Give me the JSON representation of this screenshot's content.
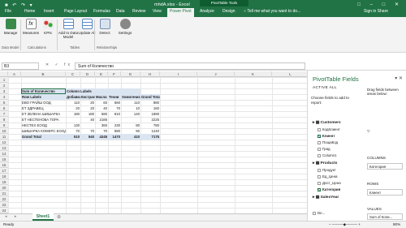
{
  "window": {
    "title": "mhdA.xlsx - Excel",
    "tools_title": "PivotTable Tools",
    "quick_access": "■ ↶ ↷ ▾",
    "window_controls": "□ – □ ✕"
  },
  "ribbon_tabs": [
    "File",
    "Home",
    "Insert",
    "Page Layout",
    "Formulas",
    "Data",
    "Review",
    "View",
    "Power Pivot",
    "Analyze",
    "Design"
  ],
  "tell_me": "○ Tell me what you want to do...",
  "user_area": "Sign in  Share",
  "ribbon": {
    "buttons": [
      "Manage",
      "Measures",
      "KPIs",
      "Add to Data Model",
      "Update All",
      "Detect",
      "Settings"
    ],
    "groups": [
      "Data Model",
      "Calculations",
      "Tables",
      "Relationships"
    ]
  },
  "formula_bar": {
    "name_box": "B3",
    "fx_icons": "✕ ✓ fx",
    "formula": "Sum of Количество"
  },
  "columns": [
    "A",
    "B",
    "C",
    "D",
    "E",
    "F",
    "G",
    "H",
    "I",
    "J",
    "K",
    "L"
  ],
  "rows": [
    "1",
    "2",
    "3",
    "4",
    "5",
    "6",
    "7",
    "8",
    "9",
    "10",
    "11",
    "12",
    "13",
    "14",
    "15",
    "16",
    "17",
    "18",
    "19",
    "20",
    "21",
    "22",
    "23",
    "24"
  ],
  "pivot": {
    "value_header": "Sum of Количество",
    "column_labels": "Column Labels",
    "row_labels": "Row Labels",
    "col_headers": [
      "Добавки",
      "Екстракти",
      "Масла",
      "Течни",
      "Хомогениз",
      "Grand Total"
    ],
    "data_rows": [
      {
        "label": "ЕВО ГРАЙШ ООД",
        "values": [
          "110",
          "20",
          "60",
          "560",
          "110",
          "880"
        ]
      },
      {
        "label": "ЕТ ЗДРАВЕЦ",
        "values": [
          "20",
          "20",
          "40",
          "70",
          "10",
          "160"
        ]
      },
      {
        "label": "ЕТ ЗЕЛЕНА ШИШАРКА",
        "values": [
          "180",
          "180",
          "580",
          "810",
          "140",
          "1890"
        ]
      },
      {
        "label": "ЕТ НЕСТЕНОВА ТОРА",
        "values": [
          "",
          "40",
          "2185",
          "",
          "",
          "2225"
        ]
      },
      {
        "label": "НЕСТЕХ ЕООД",
        "values": [
          "130",
          "",
          "360",
          "230",
          "80",
          "780"
        ]
      },
      {
        "label": "ШИШАРКА КОМЕРС ЕООД",
        "values": [
          "70",
          "70",
          "70",
          "980",
          "90",
          "1240"
        ]
      }
    ],
    "grand_total_label": "Grand Total",
    "grand_totals": [
      "510",
      "540",
      "4245",
      "1470",
      "410",
      "7175"
    ]
  },
  "sheet_tab": "Sheet1",
  "status": {
    "ready": "Ready",
    "zoom": "80%",
    "zoom_controls": "– ———◆——— +"
  },
  "pivot_panel": {
    "title": "PivotTable Fields",
    "tabs": "ACTIVE    ALL",
    "choose_text": "Choose fields to add to report:",
    "drag_text": "Drag fields between areas below:",
    "tables": [
      {
        "name": "Customers",
        "fields": [
          {
            "name": "КодКлиент",
            "checked": false
          },
          {
            "name": "Клиент",
            "checked": true
          },
          {
            "name": "ПощаКод",
            "checked": false
          },
          {
            "name": "Град",
            "checked": false
          },
          {
            "name": "Column1",
            "checked": false
          }
        ]
      },
      {
        "name": "Products",
        "fields": [
          {
            "name": "Продукт",
            "checked": false
          },
          {
            "name": "Ед_Цена",
            "checked": false
          },
          {
            "name": "Дост_Цена",
            "checked": false
          },
          {
            "name": "Категория",
            "checked": true
          }
        ]
      },
      {
        "name": "SalesYear",
        "fields": []
      }
    ],
    "areas": {
      "columns_label": "COLUMNS",
      "columns_value": "Категория",
      "rows_label": "ROWS",
      "rows_value": "Клиент",
      "values_label": "VALUES",
      "values_value": "Sum of Коли...",
      "defer_label": "De...",
      "update_label": "Update"
    }
  },
  "colors": {
    "accent": "#217346",
    "pivot_header": "#dbe5f1"
  }
}
